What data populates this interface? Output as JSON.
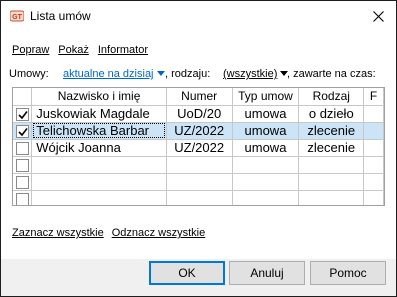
{
  "window": {
    "title": "Lista umów"
  },
  "menu": {
    "items": [
      "Popraw",
      "Pokaż",
      "Informator"
    ]
  },
  "filters": {
    "contracts_label": "Umowy:",
    "contracts_value": "aktualne na dzisiaj",
    "type_label": ", rodzaju:",
    "type_value": "(wszystkie)",
    "concluded_label": ", zawarte na czas:"
  },
  "table": {
    "columns": [
      "Nazwisko i imię",
      "Numer",
      "Typ umow",
      "Rodzaj",
      "F"
    ],
    "rows": [
      {
        "checked": true,
        "name": "Juskowiak Magdale",
        "number": "UoD/20",
        "type": "umowa",
        "kind": "o dzieło",
        "f": "",
        "selected": false
      },
      {
        "checked": true,
        "name": "Telichowska Barbar",
        "number": "UZ/2022",
        "type": "umowa",
        "kind": "zlecenie",
        "f": "",
        "selected": true
      },
      {
        "checked": false,
        "name": "Wójcik Joanna",
        "number": "UZ/2022",
        "type": "umowa",
        "kind": "zlecenie",
        "f": "",
        "selected": false
      },
      {
        "checked": false,
        "name": "",
        "number": "",
        "type": "",
        "kind": "",
        "f": "",
        "selected": false
      },
      {
        "checked": false,
        "name": "",
        "number": "",
        "type": "",
        "kind": "",
        "f": "",
        "selected": false
      },
      {
        "checked": false,
        "name": "",
        "number": "",
        "type": "",
        "kind": "",
        "f": "",
        "selected": false
      }
    ]
  },
  "links": {
    "select_all": "Zaznacz wszystkie",
    "deselect_all": "Odznacz wszystkie"
  },
  "buttons": {
    "ok": "OK",
    "cancel": "Anuluj",
    "help": "Pomoc"
  },
  "colors": {
    "selection": "#cce4f7",
    "link_blue": "#0066cc",
    "default_button_border": "#0078d7"
  }
}
